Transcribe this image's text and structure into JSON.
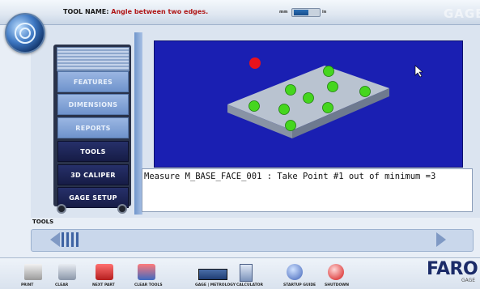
{
  "header": {
    "tool_name_label": "TOOL NAME:",
    "tool_name_value": "Angle between two edges.",
    "unit_left": "mm",
    "unit_right": "in",
    "brand_faded": "GAGE"
  },
  "nav": {
    "items": [
      {
        "label": "FEATURES",
        "style": "soft"
      },
      {
        "label": "DIMENSIONS",
        "style": "soft"
      },
      {
        "label": "REPORTS",
        "style": "soft"
      },
      {
        "label": "TOOLS",
        "style": "hard"
      },
      {
        "label": "3D CALIPER",
        "style": "hard"
      },
      {
        "label": "GAGE SETUP",
        "style": "hard"
      }
    ]
  },
  "message": "Measure M_BASE_FACE_001 : Take Point #1 out of minimum =3",
  "tools": {
    "label": "TOOLS"
  },
  "toolbar": [
    {
      "label": "PRINT",
      "icon": "printer-icon"
    },
    {
      "label": "CLEAR",
      "icon": "clear-icon"
    },
    {
      "label": "NEXT PART",
      "icon": "next-part-icon"
    },
    {
      "label": "CLEAR TOOLS",
      "icon": "clear-tools-icon"
    },
    {
      "label": "GAGE | METROLOGY",
      "icon": "mode-switch-icon"
    },
    {
      "label": "CALCULATOR",
      "icon": "calculator-icon"
    },
    {
      "label": "STARTUP GUIDE",
      "icon": "help-icon"
    },
    {
      "label": "SHUTDOWN",
      "icon": "shutdown-icon"
    }
  ],
  "brand": {
    "logo_text": "FARO",
    "sub_text": "GAGE"
  },
  "colors": {
    "viewport_bg": "#1a1fb2",
    "active_point": "#e8121c",
    "point": "#45d61e"
  }
}
